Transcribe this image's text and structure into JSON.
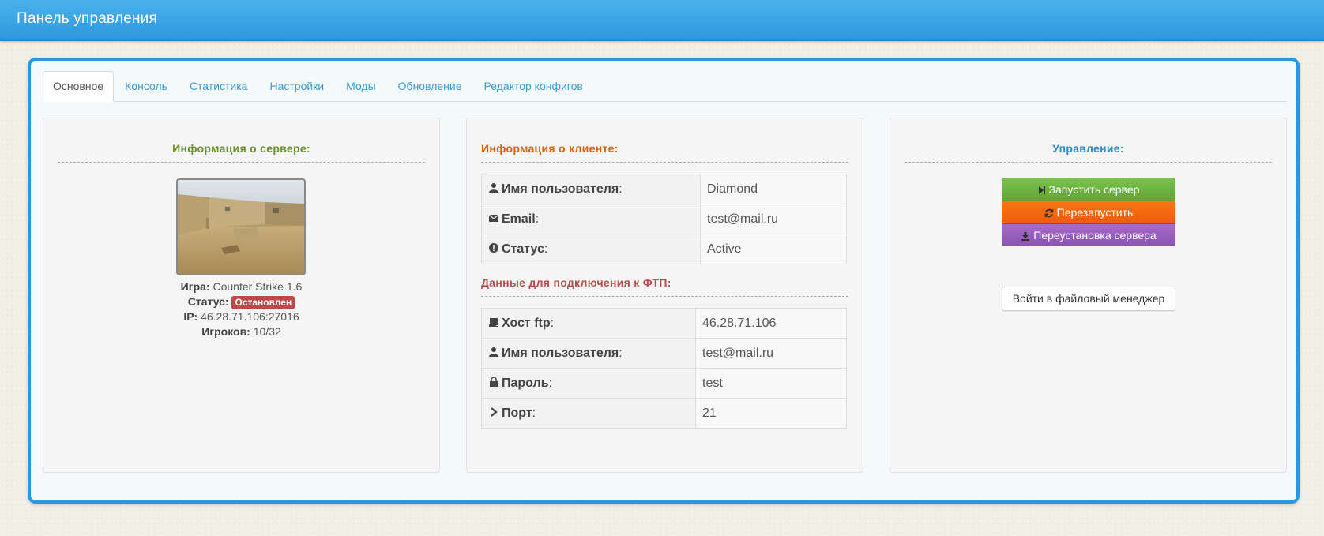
{
  "header": {
    "title": "Панель управления"
  },
  "tabs": [
    {
      "label": "Основное"
    },
    {
      "label": "Консоль"
    },
    {
      "label": "Статистика"
    },
    {
      "label": "Настройки"
    },
    {
      "label": "Моды"
    },
    {
      "label": "Обновление"
    },
    {
      "label": "Редактор конфигов"
    }
  ],
  "server_info": {
    "title": "Информация о сервере:",
    "game_label": "Игра:",
    "game_value": "Counter Strike 1.6",
    "status_label": "Статус:",
    "status_value": "Остановлен",
    "ip_label": "IP:",
    "ip_value": "46.28.71.106:27016",
    "players_label": "Игроков:",
    "players_value": "10/32"
  },
  "client_info": {
    "title": "Информация о клиенте:",
    "rows": [
      {
        "icon": "user-icon",
        "key": "Имя пользователя",
        "value": "Diamond"
      },
      {
        "icon": "envelope-icon",
        "key": "Email",
        "value": "test@mail.ru"
      },
      {
        "icon": "exclamation-circle-icon",
        "key": "Статус",
        "value": "Active"
      }
    ]
  },
  "ftp_info": {
    "title": "Данные для подключения к ФТП:",
    "rows": [
      {
        "icon": "hdd-icon",
        "key": "Хост ftp",
        "value": "46.28.71.106"
      },
      {
        "icon": "user-icon",
        "key": "Имя пользователя",
        "value": "test@mail.ru"
      },
      {
        "icon": "lock-icon",
        "key": "Пароль",
        "value": "test"
      },
      {
        "icon": "chevron-right-icon",
        "key": "Порт",
        "value": "21"
      }
    ]
  },
  "control": {
    "title": "Управление:",
    "start_label": "Запустить сервер",
    "restart_label": "Перезапустить",
    "reinstall_label": "Переустановка сервера",
    "file_manager_label": "Войти в файловый менеджер"
  },
  "colors": {
    "server_title": "#6a8f2f",
    "client_title": "#d8600f",
    "ftp_title": "#b94a48",
    "control_title": "#2b8ac7",
    "start_button": "#6cb343",
    "restart_button": "#f66a0e",
    "reinstall_button": "#995fbd"
  }
}
